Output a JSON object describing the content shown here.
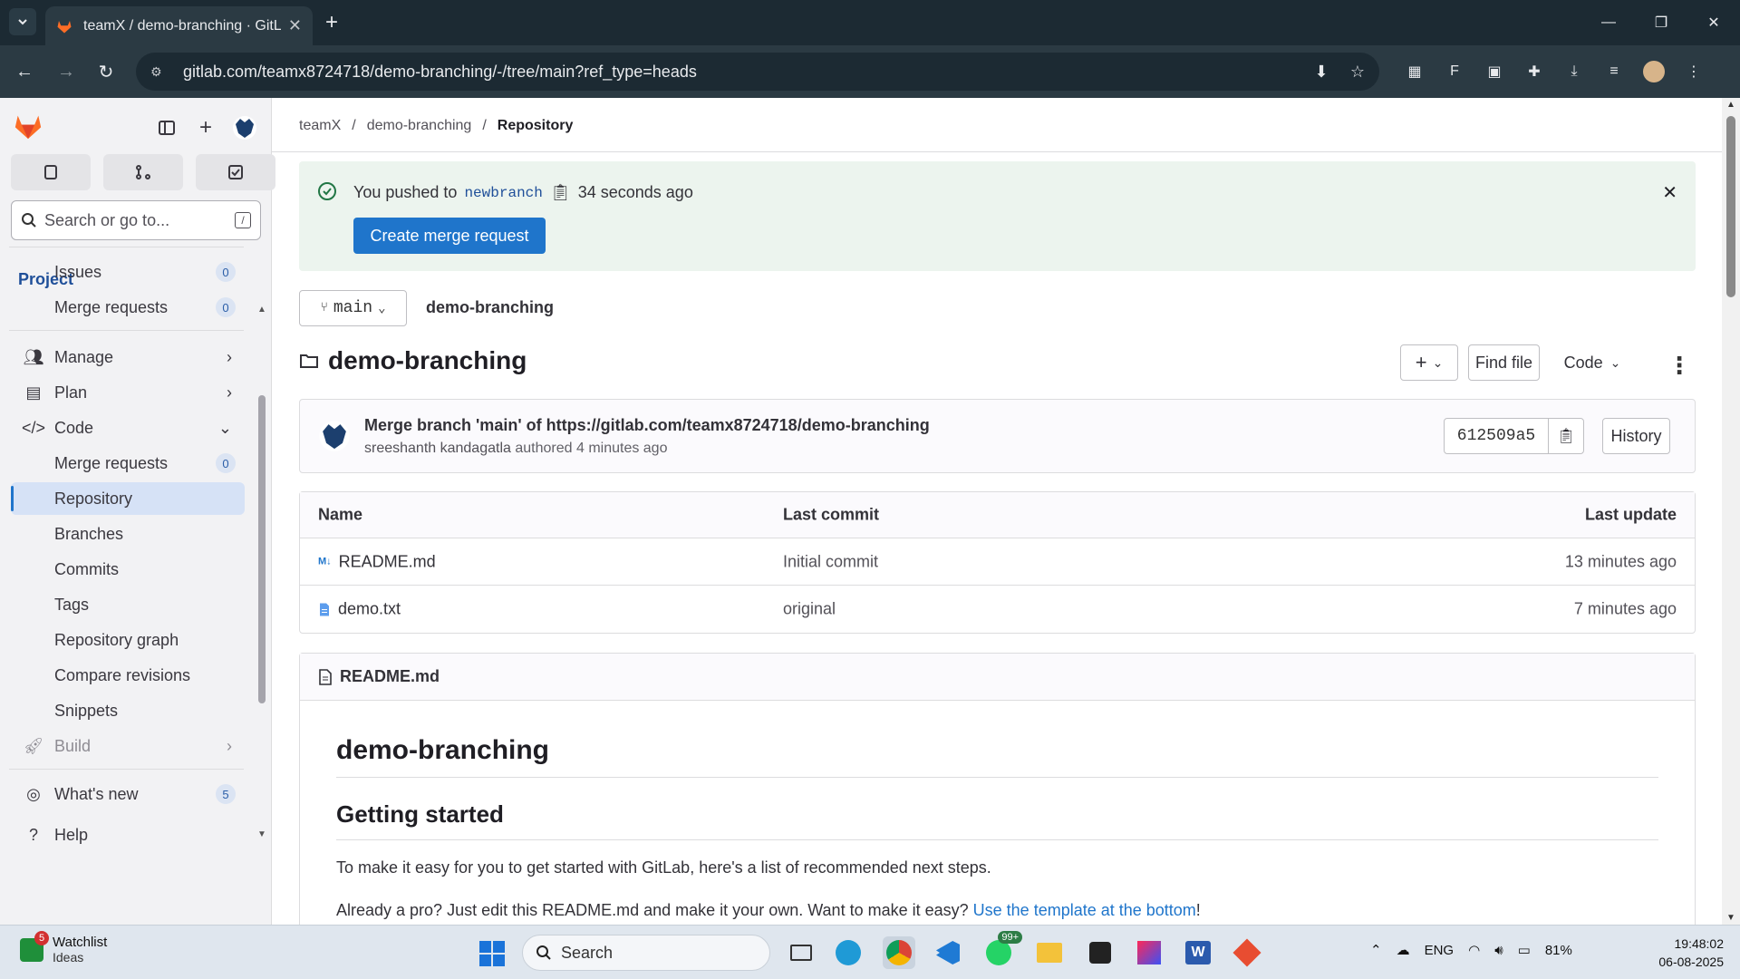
{
  "browser": {
    "tab_title": "teamX / demo-branching · GitL",
    "url": "gitlab.com/teamx8724718/demo-branching/-/tree/main?ref_type=heads"
  },
  "sidebar": {
    "search_placeholder": "Search or go to...",
    "search_shortcut": "/",
    "section_title": "Project",
    "items": [
      {
        "label": "Issues",
        "badge": "0"
      },
      {
        "label": "Merge requests",
        "badge": "0"
      },
      {
        "label": "Manage"
      },
      {
        "label": "Plan"
      },
      {
        "label": "Code"
      },
      {
        "label": "Merge requests",
        "badge": "0"
      },
      {
        "label": "Repository"
      },
      {
        "label": "Branches"
      },
      {
        "label": "Commits"
      },
      {
        "label": "Tags"
      },
      {
        "label": "Repository graph"
      },
      {
        "label": "Compare revisions"
      },
      {
        "label": "Snippets"
      },
      {
        "label": "Build"
      }
    ],
    "whats_new": {
      "label": "What's new",
      "badge": "5"
    },
    "help": "Help"
  },
  "breadcrumb": {
    "group": "teamX",
    "project": "demo-branching",
    "current": "Repository"
  },
  "alert": {
    "prefix": "You pushed to",
    "branch": "newbranch",
    "time": "34 seconds ago",
    "button": "Create merge request"
  },
  "branch_selector": {
    "value": "main"
  },
  "project_crumb": "demo-branching",
  "repo_title": "demo-branching",
  "actions": {
    "plus": "+",
    "find_file": "Find file",
    "code": "Code"
  },
  "last_commit": {
    "title": "Merge branch 'main' of https://gitlab.com/teamx8724718/demo-branching",
    "author": "sreeshanth kandagatla",
    "meta": "authored 4 minutes ago",
    "sha": "612509a5",
    "history": "History"
  },
  "file_table": {
    "headers": [
      "Name",
      "Last commit",
      "Last update"
    ],
    "rows": [
      {
        "name": "README.md",
        "commit": "Initial commit",
        "updated": "13 minutes ago"
      },
      {
        "name": "demo.txt",
        "commit": "original",
        "updated": "7 minutes ago"
      }
    ]
  },
  "readme": {
    "filename": "README.md",
    "h1": "demo-branching",
    "h2": "Getting started",
    "p1": "To make it easy for you to get started with GitLab, here's a list of recommended next steps.",
    "p2_text": "Already a pro? Just edit this README.md and make it your own. Want to make it easy?",
    "p2_link": "Use the template at the bottom",
    "p2_end": "!"
  },
  "taskbar": {
    "watchlist_title": "Watchlist",
    "watchlist_sub": "Ideas",
    "watchlist_badge": "5",
    "search": "Search",
    "whatsapp_badge": "99+",
    "lang": "ENG",
    "battery": "81%",
    "time": "19:48:02",
    "date": "06-08-2025"
  }
}
